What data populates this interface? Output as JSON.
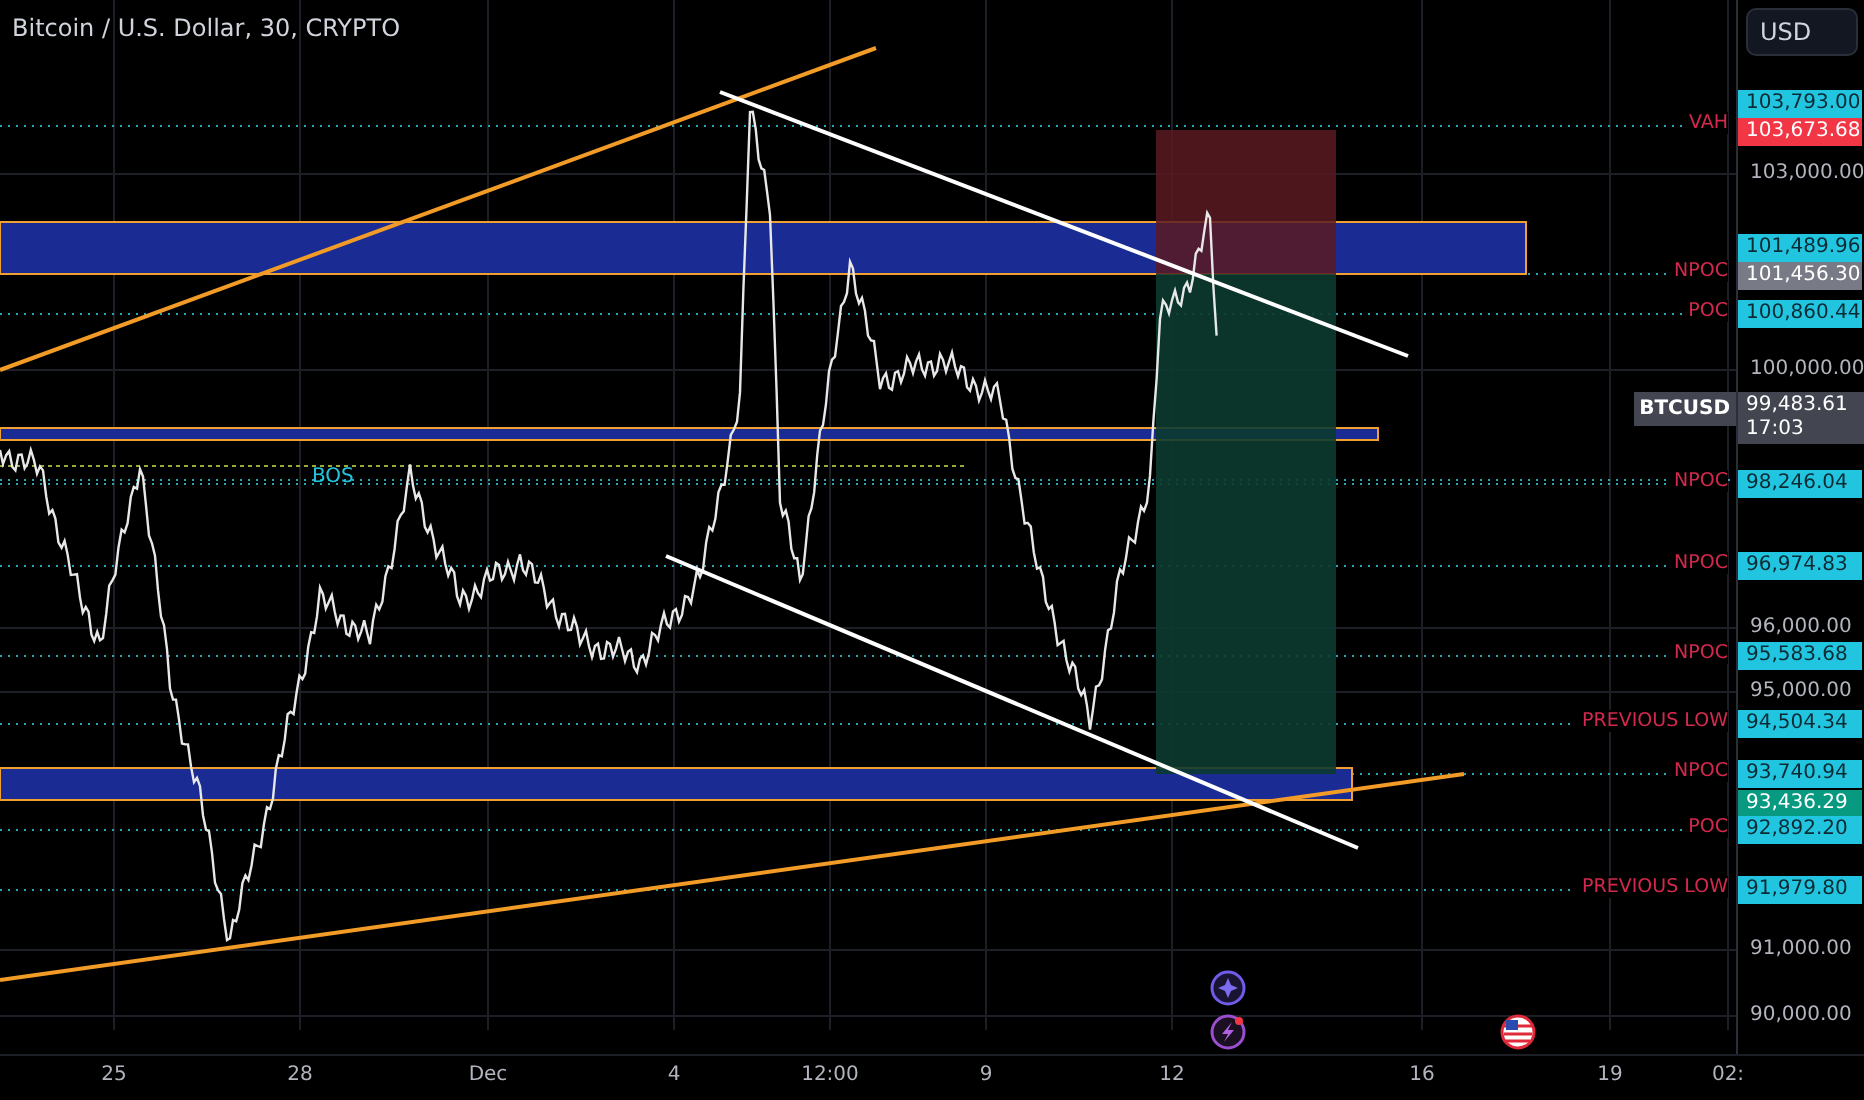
{
  "chart": {
    "title": "Bitcoin / U.S. Dollar, 30, CRYPTO",
    "annotations": [
      {
        "text": "BOS"
      }
    ],
    "levels": [
      {
        "label": "VAH"
      },
      {
        "label": "NPOC"
      },
      {
        "label": "POC"
      },
      {
        "label": "NPOC"
      },
      {
        "label": "NPOC"
      },
      {
        "label": "NPOC"
      },
      {
        "label": "PREVIOUS LOW"
      },
      {
        "label": "NPOC"
      },
      {
        "label": "POC"
      },
      {
        "label": "PREVIOUS LOW"
      }
    ]
  },
  "price_scale": {
    "currency_button": "USD",
    "labels": [
      {
        "text": "103,793.00",
        "kind": "tag",
        "color": "#22c5e0"
      },
      {
        "text": "103,673.68",
        "kind": "tag",
        "color": "#f23645"
      },
      {
        "text": "103,000.00",
        "kind": "tick"
      },
      {
        "text": "101,489.96",
        "kind": "tag",
        "color": "#22c5e0"
      },
      {
        "text": "101,456.30",
        "kind": "tag",
        "color": "#787b86"
      },
      {
        "text": "100,860.44",
        "kind": "tag",
        "color": "#22c5e0"
      },
      {
        "text": "100,000.00",
        "kind": "tick"
      },
      {
        "text": "98,246.04",
        "kind": "tag",
        "color": "#22c5e0"
      },
      {
        "text": "96,974.83",
        "kind": "tag",
        "color": "#22c5e0"
      },
      {
        "text": "96,000.00",
        "kind": "tick"
      },
      {
        "text": "95,583.68",
        "kind": "tag",
        "color": "#22c5e0"
      },
      {
        "text": "95,000.00",
        "kind": "tick"
      },
      {
        "text": "94,504.34",
        "kind": "tag",
        "color": "#22c5e0"
      },
      {
        "text": "93,740.94",
        "kind": "tag",
        "color": "#22c5e0"
      },
      {
        "text": "93,436.29",
        "kind": "tag",
        "color": "#089981"
      },
      {
        "text": "92,892.20",
        "kind": "tag",
        "color": "#22c5e0"
      },
      {
        "text": "91,979.80",
        "kind": "tag",
        "color": "#22c5e0"
      },
      {
        "text": "91,000.00",
        "kind": "tick"
      },
      {
        "text": "90,000.00",
        "kind": "tick"
      }
    ],
    "last_price": {
      "symbol": "BTCUSD",
      "price": "99,483.61",
      "countdown": "17:03"
    }
  },
  "time_axis": {
    "labels": [
      "25",
      "28",
      "Dec",
      "4",
      "12:00",
      "9",
      "12",
      "16",
      "19",
      "02:"
    ]
  }
}
